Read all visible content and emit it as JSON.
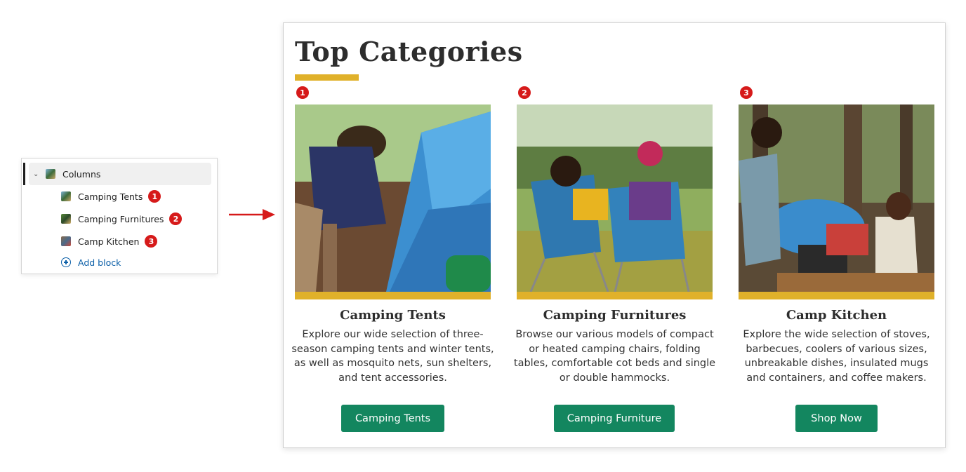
{
  "block_tree": {
    "parent": {
      "label": "Columns",
      "icon": "columns-block-icon"
    },
    "children": [
      {
        "label": "Camping Tents",
        "badge": "1"
      },
      {
        "label": "Camping Furnitures",
        "badge": "2"
      },
      {
        "label": "Camp Kitchen",
        "badge": "3"
      }
    ],
    "add_block_label": "Add block"
  },
  "preview": {
    "title": "Top Categories",
    "accent_color": "#e0b12a",
    "button_color": "#13865f",
    "columns": [
      {
        "number": "1",
        "heading": "Camping Tents",
        "description": "Explore our wide selection of three-season camping tents and winter tents, as well as mosquito nets, sun shelters, and tent accessories.",
        "button": "Camping Tents",
        "image": "tent-photo"
      },
      {
        "number": "2",
        "heading": "Camping Furnitures",
        "description": "Browse our various models of compact or heated camping chairs, folding tables, comfortable cot beds and single or double hammocks.",
        "button": "Camping Furniture",
        "image": "camping-chairs-photo"
      },
      {
        "number": "3",
        "heading": "Camp Kitchen",
        "description": "Explore the wide selection of stoves, barbecues, coolers of various sizes, unbreakable dishes, insulated mugs and containers, and coffee makers.",
        "button": "Shop Now",
        "image": "camp-kitchen-photo"
      }
    ]
  }
}
